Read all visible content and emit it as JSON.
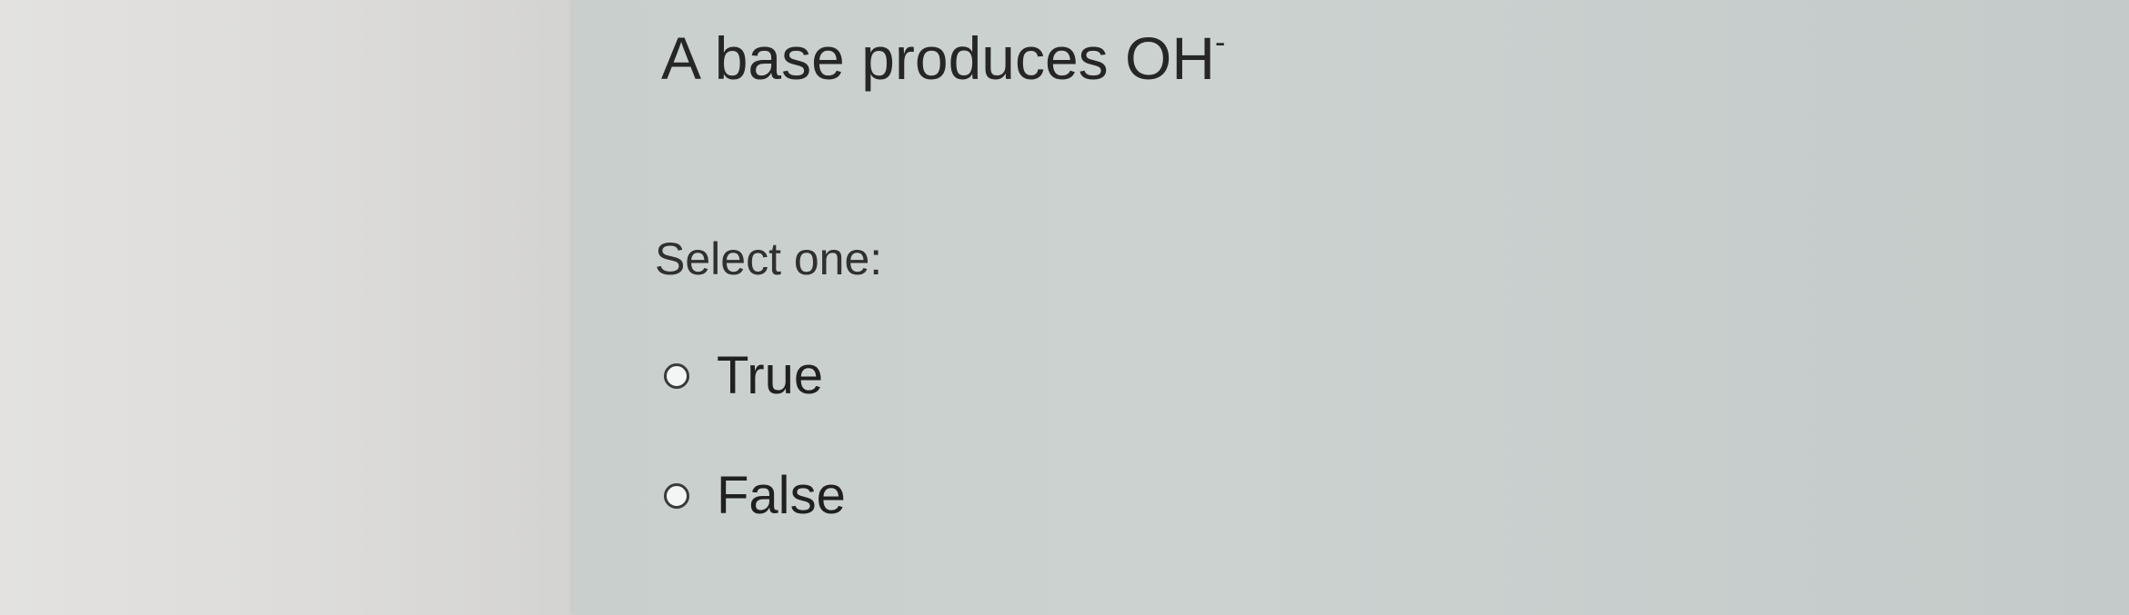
{
  "question": {
    "text": "A base produces OH",
    "superscript": "-"
  },
  "prompt": "Select one:",
  "options": [
    {
      "label": "True",
      "selected": false
    },
    {
      "label": "False",
      "selected": false
    }
  ]
}
